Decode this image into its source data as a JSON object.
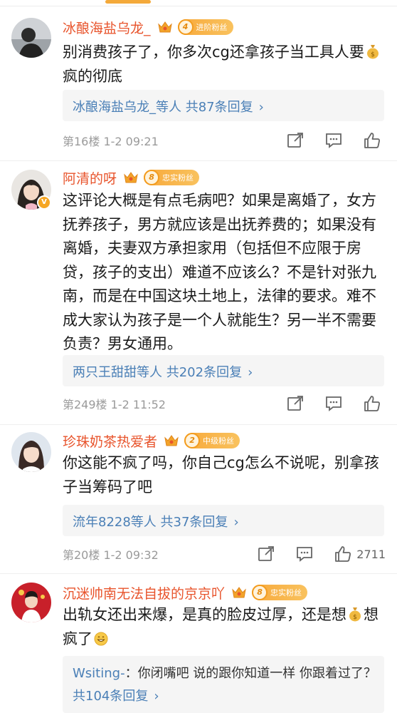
{
  "comments": [
    {
      "username": "冰酿海盐乌龙_",
      "fan_level": "4",
      "fan_label": "进阶粉丝",
      "text_before_emoji": "别消费孩子了，你多次cg还拿孩子当工具人要",
      "emoji": "money-bag",
      "text_after_emoji": "疯的彻底",
      "reply_summary": "冰酿海盐乌龙_等人  共87条回复",
      "floor_time": "第16楼  1-2 09:21",
      "like_count": ""
    },
    {
      "username": "阿清的呀",
      "fan_level": "8",
      "fan_label": "忠实粉丝",
      "text": "这评论大概是有点毛病吧？如果是离婚了，女方抚养孩子，男方就应该是出抚养费的；如果没有离婚，夫妻双方承担家用（包括但不应限于房贷，孩子的支出）难道不应该么？不是针对张九南，而是在中国这块土地上，法律的要求。难不成大家认为孩子是一个人就能生？另一半不需要负责？男女通用。",
      "reply_summary": "两只王甜甜等人  共202条回复",
      "floor_time": "第249楼  1-2 11:52",
      "like_count": ""
    },
    {
      "username": "珍珠奶茶热爱者",
      "fan_level": "2",
      "fan_label": "中级粉丝",
      "text": "你这能不疯了吗，你自己cg怎么不说呢，别拿孩子当筹码了吧",
      "reply_summary": "流年8228等人  共37条回复",
      "floor_time": "第20楼  1-2 09:32",
      "like_count": "2711"
    },
    {
      "username": "沉迷帅南无法自拔的京京吖",
      "fan_level": "8",
      "fan_label": "忠实粉丝",
      "text_before_emoji": "出轨女还出来爆，是真的脸皮过厚，还是想",
      "emoji": "money-bag",
      "text_after_emoji": "想疯了",
      "emoji2": "grin-face",
      "reply_replier": "Wsiting-",
      "reply_text": "：你闭嘴吧 说的跟你知道一样 你跟着过了？",
      "reply_summary": "共104条回复"
    }
  ],
  "icons": {
    "share": "share-icon",
    "comment": "comment-icon",
    "like": "thumbs-up-icon",
    "crown": "crown-icon",
    "money_bag": "money-bag-emoji",
    "chevron": "chevron-right-icon"
  },
  "ui": {
    "chevron": "›"
  },
  "colors": {
    "username": "#e8542c",
    "link": "#4a7fb6",
    "fan_badge": "#f7a93b",
    "meta": "#9a9a9a"
  }
}
